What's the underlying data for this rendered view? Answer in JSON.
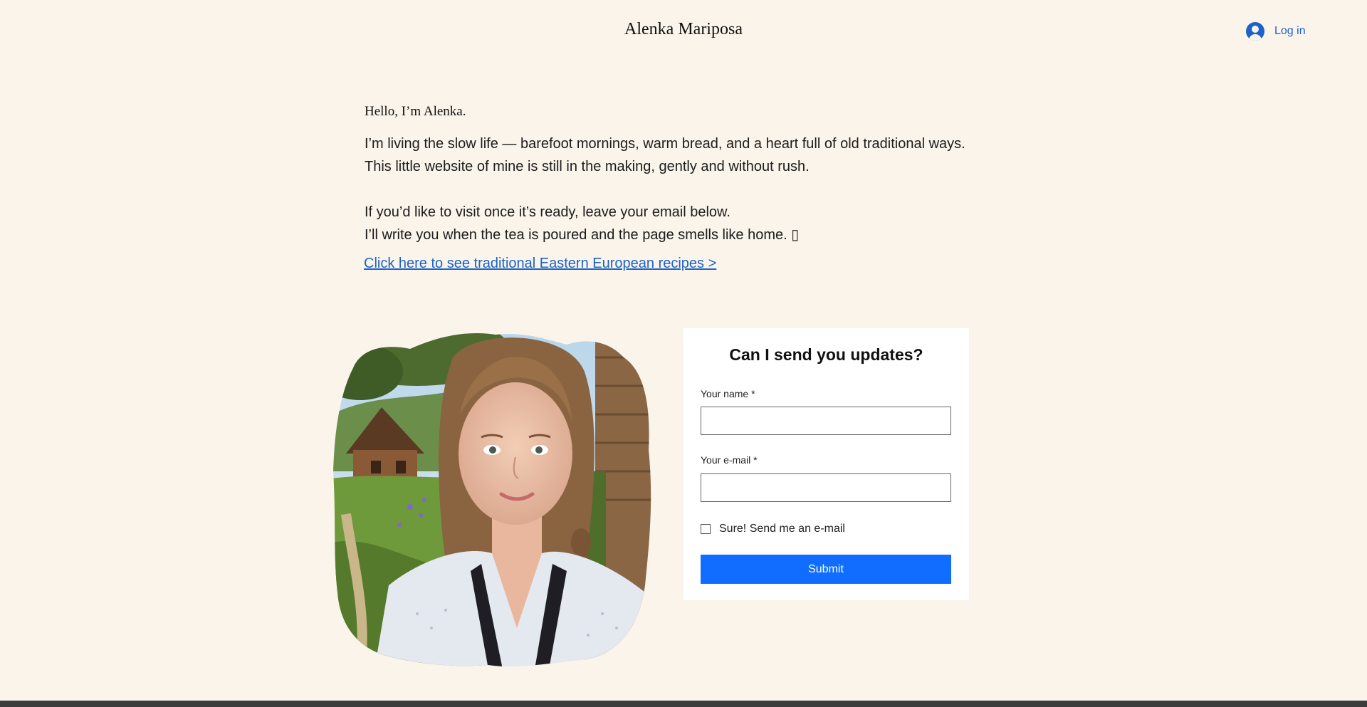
{
  "header": {
    "site_title": "Alenka Mariposa",
    "login_label": "Log in",
    "accent_color": "#1b63c9"
  },
  "intro": {
    "greeting": "Hello, I’m Alenka.",
    "paragraph1_line1": "I’m living the slow life — barefoot mornings, warm bread, and a heart full of old traditional ways.",
    "paragraph1_line2": "This little website of mine is still in the making, gently and without rush.",
    "paragraph2_line1": "If you’d like to visit once it’s ready, leave your email below.",
    "paragraph2_line2": "I’ll write you when the tea is poured and the page smells like home. ▯",
    "recipes_link": "Click here to see traditional Eastern European recipes >"
  },
  "form": {
    "title": "Can I send you updates?",
    "name_label": "Your name *",
    "name_value": "",
    "email_label": "Your e-mail *",
    "email_value": "",
    "checkbox_label": "Sure! Send me an e-mail",
    "checkbox_checked": false,
    "submit_label": "Submit",
    "submit_color": "#116dff"
  },
  "photo": {
    "icon": "portrait-photo"
  }
}
